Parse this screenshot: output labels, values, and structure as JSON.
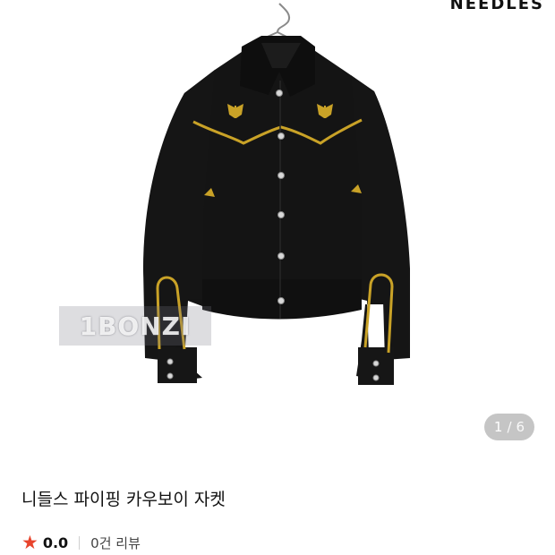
{
  "gallery": {
    "brand_logo": "NEEDLES",
    "watermark": "1BONZI",
    "page_current": "1",
    "page_separator": "/",
    "page_total": "6"
  },
  "product": {
    "title": "니들스 파이핑 카우보이 자켓",
    "rating": "0.0",
    "review_count": "0건 리뷰"
  },
  "colors": {
    "accent_star": "#e8442c",
    "jacket": "#141414",
    "piping": "#c9a227"
  }
}
